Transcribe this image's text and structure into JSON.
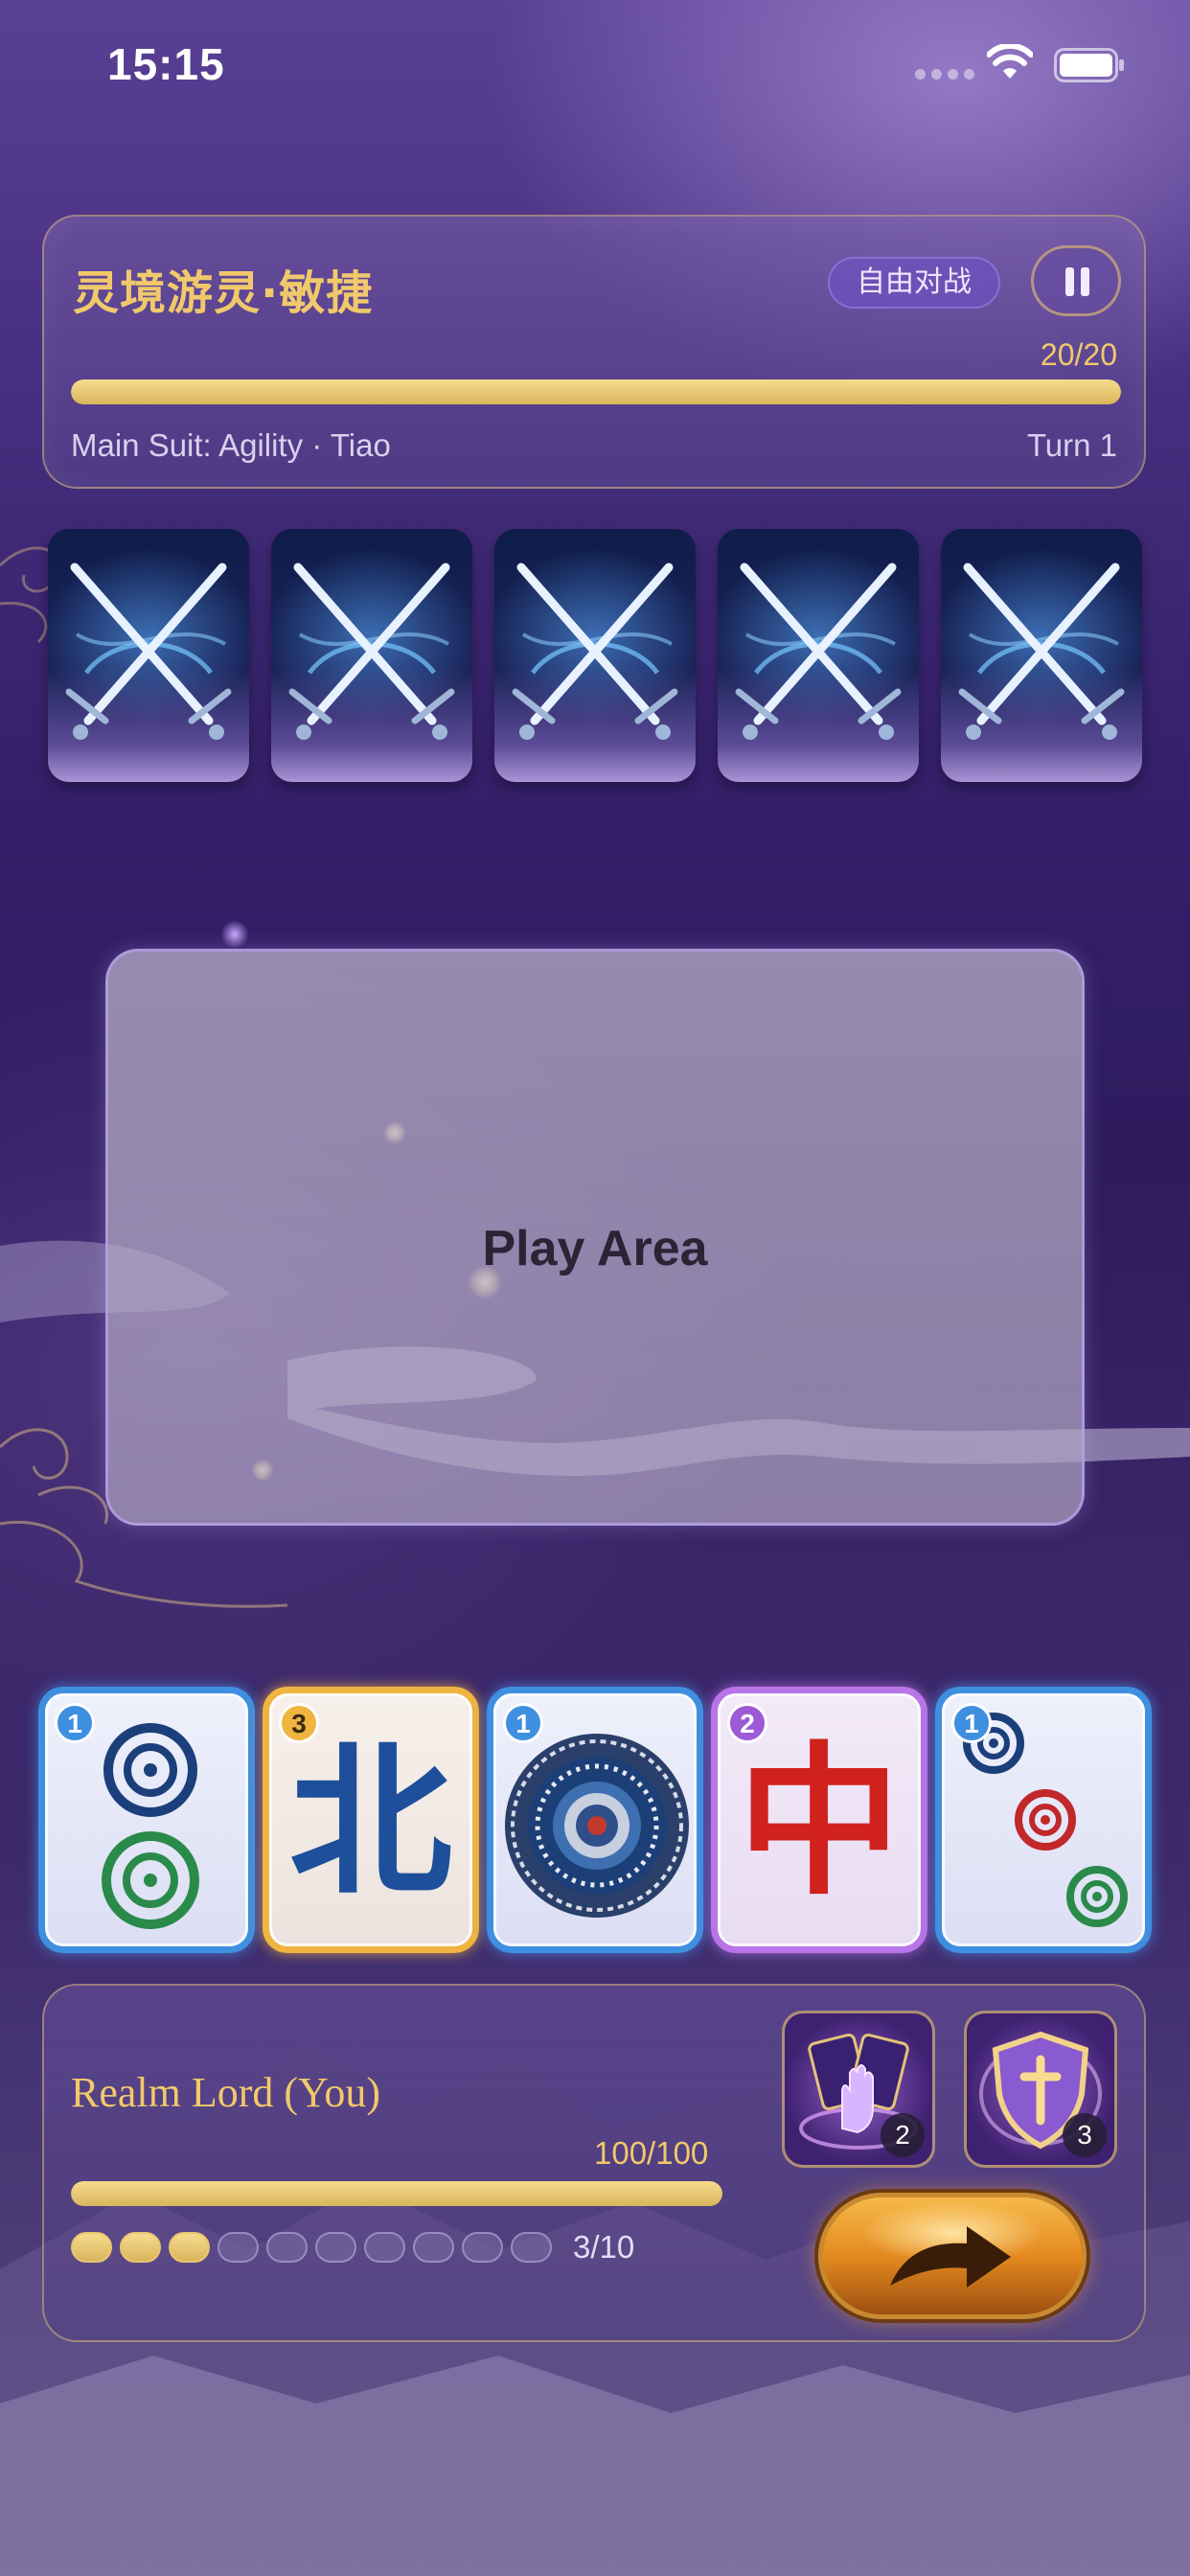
{
  "status_bar": {
    "time": "15:15",
    "icons": [
      "signal-icon",
      "wifi-icon",
      "battery-icon"
    ]
  },
  "enemy": {
    "name": "灵境游灵·敏捷",
    "mode_badge": "自由对战",
    "hp_text": "20/20",
    "hp_fraction": 1.0,
    "main_suit_label": "Main Suit: Agility · Tiao",
    "turn_label": "Turn 1",
    "cards": [
      {
        "icon": "crossed-swords-icon"
      },
      {
        "icon": "crossed-swords-icon"
      },
      {
        "icon": "crossed-swords-icon"
      },
      {
        "icon": "crossed-swords-icon"
      },
      {
        "icon": "crossed-swords-icon"
      }
    ]
  },
  "play_area": {
    "label": "Play Area"
  },
  "hand": [
    {
      "count": "1",
      "rarity": "blue",
      "tile": "two-circles-tile"
    },
    {
      "count": "3",
      "rarity": "gold",
      "tile": "north-wind-tile",
      "char": "北",
      "char_color": "#1d4f9a"
    },
    {
      "count": "1",
      "rarity": "blue",
      "tile": "one-circle-tile"
    },
    {
      "count": "2",
      "rarity": "purple",
      "tile": "red-dragon-tile",
      "char": "中",
      "char_color": "#d0211c"
    },
    {
      "count": "1",
      "rarity": "blue",
      "tile": "three-circles-tile"
    }
  ],
  "player": {
    "name": "Realm Lord (You)",
    "hp_text": "100/100",
    "hp_fraction": 1.0,
    "energy_filled": 3,
    "energy_total": 10,
    "energy_text": "3/10",
    "items": [
      {
        "icon": "hand-of-cards-icon",
        "count": "2"
      },
      {
        "icon": "shield-icon",
        "count": "3"
      }
    ],
    "end_turn_icon": "arrow-icon"
  },
  "colors": {
    "accent_gold": "#f1c96b",
    "tile_blue": "#3f8fe0",
    "tile_gold": "#f0b440",
    "tile_purple": "#b874e8"
  }
}
